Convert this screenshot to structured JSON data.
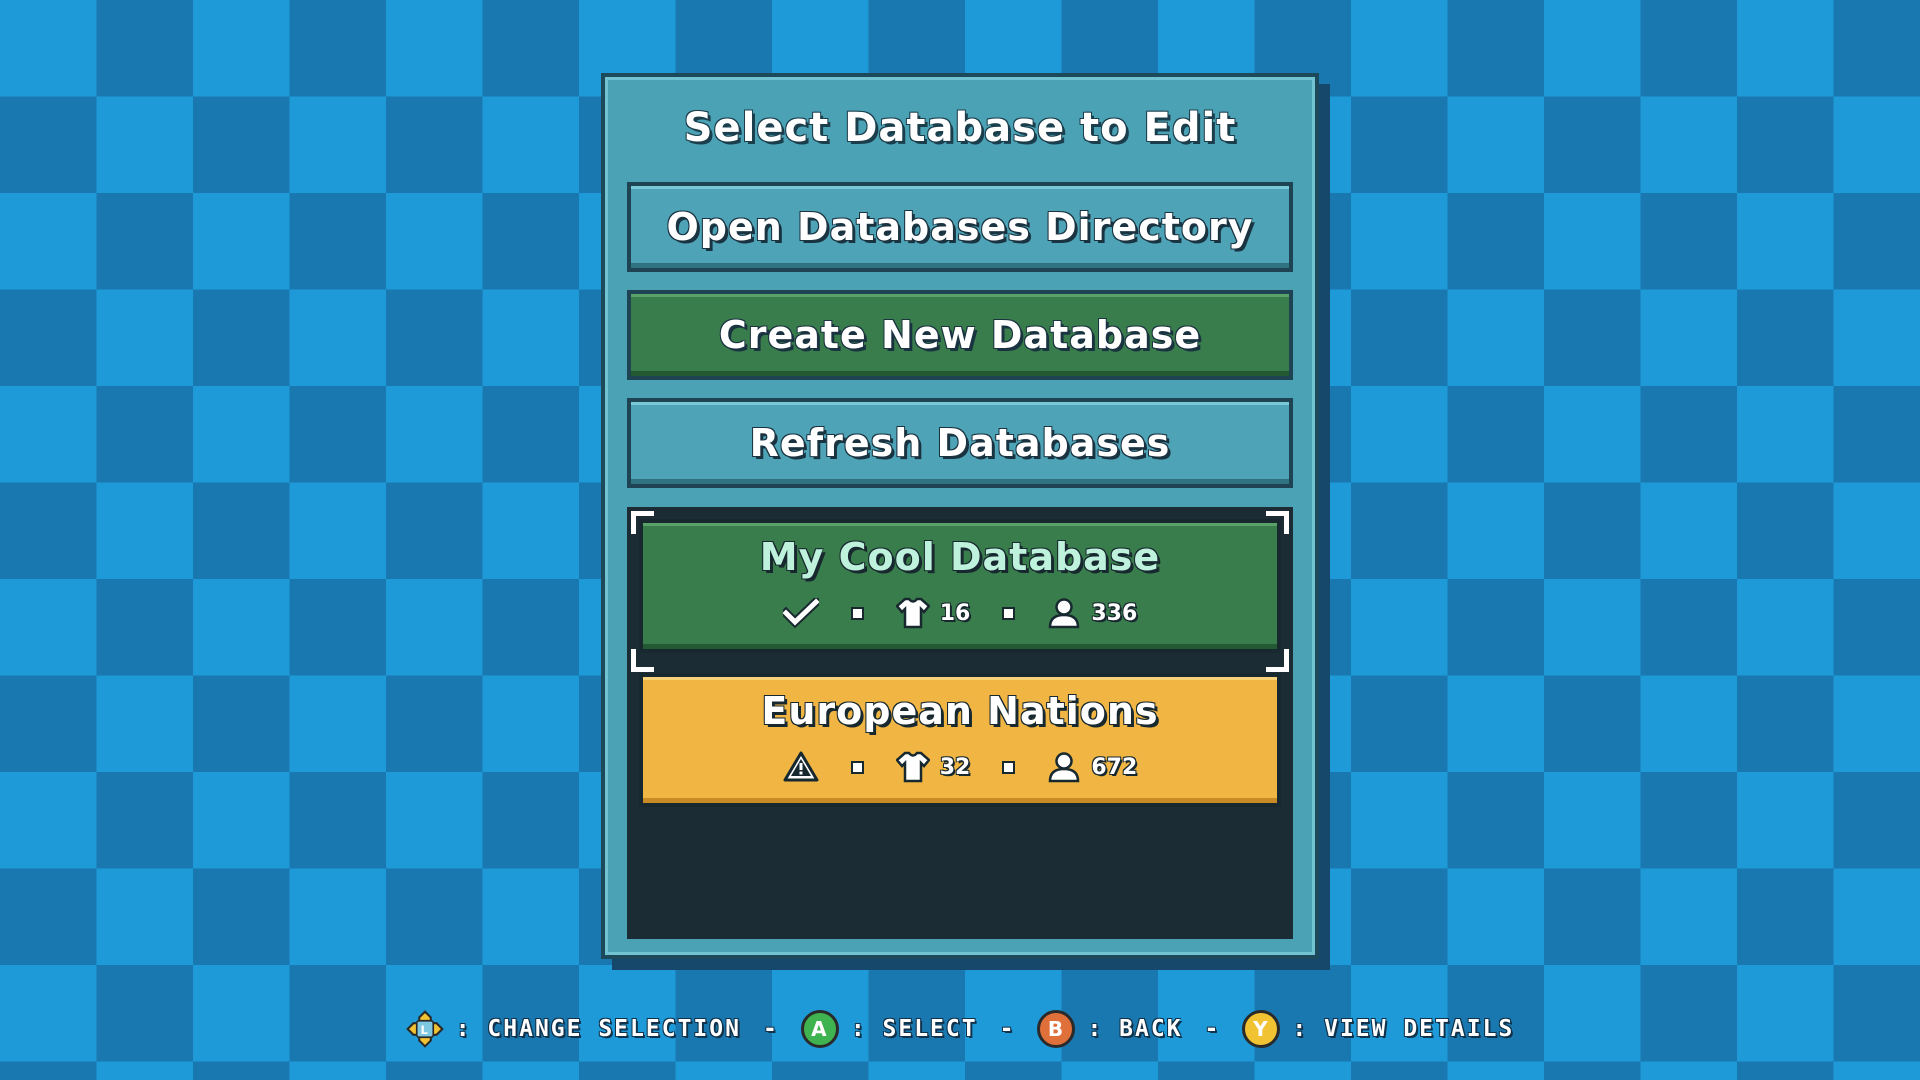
{
  "menu": {
    "title": "Select Database to Edit",
    "open_directory_label": "Open Databases Directory",
    "create_label": "Create New Database",
    "refresh_label": "Refresh Databases"
  },
  "databases": [
    {
      "name": "My Cool Database",
      "status_icon": "checkmark-icon",
      "teams": "16",
      "players": "336",
      "selected": true,
      "color": "#3a7d4c"
    },
    {
      "name": "European Nations",
      "status_icon": "warning-icon",
      "teams": "32",
      "players": "672",
      "selected": false,
      "color": "#f0b543"
    }
  ],
  "footer": {
    "change_selection": ": CHANGE SELECTION",
    "select": ": SELECT",
    "back": ": BACK",
    "view_details": ": VIEW DETAILS",
    "separator": "-",
    "a_glyph": "A",
    "b_glyph": "B",
    "y_glyph": "Y",
    "l_glyph": "L"
  },
  "colors": {
    "background_light": "#1e9ad9",
    "background_dark": "#1a78b0",
    "panel": "#4ca2b5",
    "button_blue": "#4ea3b6",
    "button_green": "#3a7d4c",
    "list_bg": "#1b2c34"
  }
}
